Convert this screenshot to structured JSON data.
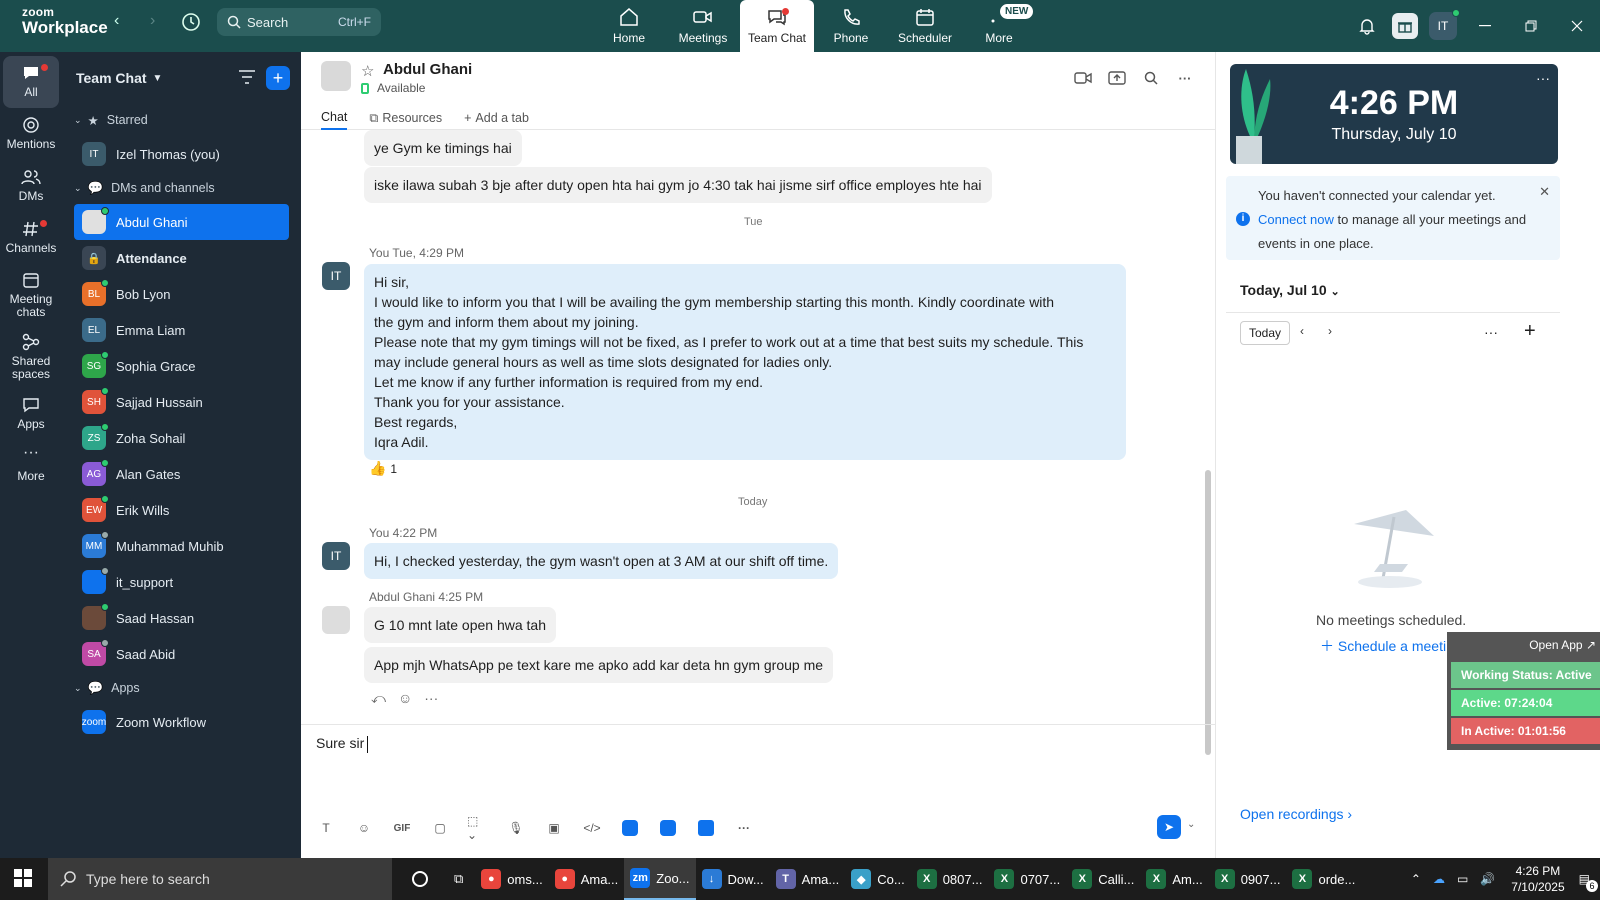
{
  "topbar": {
    "logo_line1": "zoom",
    "logo_line2": "Workplace",
    "search_label": "Search",
    "search_shortcut": "Ctrl+F",
    "tabs": [
      {
        "label": "Home",
        "icon": "home-icon"
      },
      {
        "label": "Meetings",
        "icon": "video-icon"
      },
      {
        "label": "Team Chat",
        "icon": "chat-icon",
        "active": true
      },
      {
        "label": "Phone",
        "icon": "phone-icon"
      },
      {
        "label": "Scheduler",
        "icon": "calendar-icon"
      },
      {
        "label": "More",
        "icon": "more-icon"
      }
    ],
    "new_badge": "NEW",
    "user_initials": "IT"
  },
  "rail": [
    {
      "label": "All",
      "icon": "chat-bubble-icon",
      "active": true
    },
    {
      "label": "Mentions",
      "icon": "at-icon"
    },
    {
      "label": "DMs",
      "icon": "people-icon"
    },
    {
      "label": "Channels",
      "icon": "hash-icon"
    },
    {
      "label": "Meeting chats",
      "icon": "calendar-icon"
    },
    {
      "label": "Shared spaces",
      "icon": "share-icon"
    },
    {
      "label": "Apps",
      "icon": "apps-icon"
    },
    {
      "label": "More",
      "icon": "ellipsis-icon"
    }
  ],
  "sidebar": {
    "title": "Team Chat",
    "starred_label": "Starred",
    "starred": [
      {
        "initials": "IT",
        "name": "Izel Thomas (you)",
        "color": "#3b5b6b"
      }
    ],
    "dms_label": "DMs and channels",
    "dms": [
      {
        "initials": "",
        "name": "Abdul Ghani",
        "color": "#e0e0e0",
        "selected": true,
        "presence": "on"
      },
      {
        "initials": "",
        "name": "Attendance",
        "color": "#3a4654",
        "bold": true,
        "lock": true
      },
      {
        "initials": "BL",
        "name": "Bob Lyon",
        "color": "#e8702a",
        "presence": "on"
      },
      {
        "initials": "EL",
        "name": "Emma Liam",
        "color": "#3b6b8a"
      },
      {
        "initials": "SG",
        "name": "Sophia Grace",
        "color": "#2ea64a",
        "presence": "on"
      },
      {
        "initials": "SH",
        "name": "Sajjad Hussain",
        "color": "#e0533a",
        "presence": "on"
      },
      {
        "initials": "ZS",
        "name": "Zoha Sohail",
        "color": "#2ea68a",
        "presence": "on"
      },
      {
        "initials": "AG",
        "name": "Alan Gates",
        "color": "#8a5bd6",
        "presence": "on"
      },
      {
        "initials": "EW",
        "name": "Erik Wills",
        "color": "#e0533a",
        "presence": "on"
      },
      {
        "initials": "MM",
        "name": "Muhammad Muhib",
        "color": "#2b7bd6",
        "presence": "off"
      },
      {
        "initials": "",
        "name": "it_support",
        "color": "#0e72ed",
        "presence": "off"
      },
      {
        "initials": "",
        "name": "Saad Hassan",
        "color": "#6b4a3a",
        "presence": "on"
      },
      {
        "initials": "SA",
        "name": "Saad Abid",
        "color": "#c04aa6",
        "presence": "off"
      }
    ],
    "apps_label": "Apps",
    "apps": [
      {
        "initials": "zoom",
        "name": "Zoom Workflow",
        "color": "#0e72ed"
      }
    ]
  },
  "chat": {
    "contact_name": "Abdul Ghani",
    "status": "Available",
    "tabs": [
      "Chat",
      "Resources",
      "Add a tab"
    ],
    "messages": {
      "m1": "ye Gym ke timings hai",
      "m2": "iske ilawa subah 3 bje after duty open hta hai gym jo 4:30 tak hai jisme sirf office employes hte hai",
      "day1": "Tue",
      "meta1_name": "You",
      "meta1_time": "Tue, 4:29 PM",
      "long_lines": [
        "Hi sir,",
        "I would like to inform you that I will be availing the gym membership starting this month. Kindly coordinate with",
        "the gym and inform them about my joining.",
        "Please note that my gym timings will not be fixed, as I prefer to work out at a time that best suits my schedule. This",
        "may include general hours as well as time slots designated for ladies only.",
        "Let me know if any further information is required from my end.",
        "Thank you for your assistance.",
        "Best regards,",
        "Iqra Adil."
      ],
      "reaction_count": "1",
      "day2": "Today",
      "meta2_name": "You",
      "meta2_time": "4:22 PM",
      "m3": "Hi, I checked yesterday, the gym wasn't open at 3 AM at our shift off time.",
      "meta3_name": "Abdul Ghani",
      "meta3_time": "4:25 PM",
      "m4": "G 10 mnt late open hwa tah",
      "m5": "App mjh WhatsApp pe text kare me apko add kar deta hn gym group me"
    },
    "my_initials": "IT",
    "composer_text": "Sure sir",
    "toolbar": [
      "T",
      "☺",
      "GIF"
    ]
  },
  "right_panel": {
    "time": "4:26 PM",
    "date": "Thursday, July 10",
    "calendar_note_pre": "You haven't connected your calendar yet. ",
    "calendar_note_link": "Connect now",
    "calendar_note_post": " to manage all your meetings and events in one place.",
    "today_dropdown": "Today, Jul 10",
    "today_button": "Today",
    "no_meetings": "No meetings scheduled.",
    "schedule_link": "Schedule a meeting",
    "open_recordings": "Open recordings"
  },
  "widget": {
    "open_app": "Open App",
    "working_status": "Working Status: Active",
    "active": "Active: 07:24:04",
    "inactive": "In Active: 01:01:56"
  },
  "taskbar": {
    "search_placeholder": "Type here to search",
    "apps": [
      {
        "label": "oms...",
        "color": "#e8453c",
        "glyph": "●"
      },
      {
        "label": "Ama...",
        "color": "#e8453c",
        "glyph": "●"
      },
      {
        "label": "Zoo...",
        "color": "#0e72ed",
        "glyph": "zm",
        "active": true
      },
      {
        "label": "Dow...",
        "color": "#2b7bd6",
        "glyph": "↓"
      },
      {
        "label": "Ama...",
        "color": "#6264a7",
        "glyph": "T"
      },
      {
        "label": "Co...",
        "color": "#3aa0c8",
        "glyph": "◆"
      },
      {
        "label": "0807...",
        "color": "#1d6f42",
        "glyph": "X"
      },
      {
        "label": "0707...",
        "color": "#1d6f42",
        "glyph": "X"
      },
      {
        "label": "Calli...",
        "color": "#1d6f42",
        "glyph": "X"
      },
      {
        "label": "Am...",
        "color": "#1d6f42",
        "glyph": "X"
      },
      {
        "label": "0907...",
        "color": "#1d6f42",
        "glyph": "X"
      },
      {
        "label": "orde...",
        "color": "#1d6f42",
        "glyph": "X"
      }
    ],
    "time": "4:26 PM",
    "date": "7/10/2025",
    "notif_count": "6"
  }
}
